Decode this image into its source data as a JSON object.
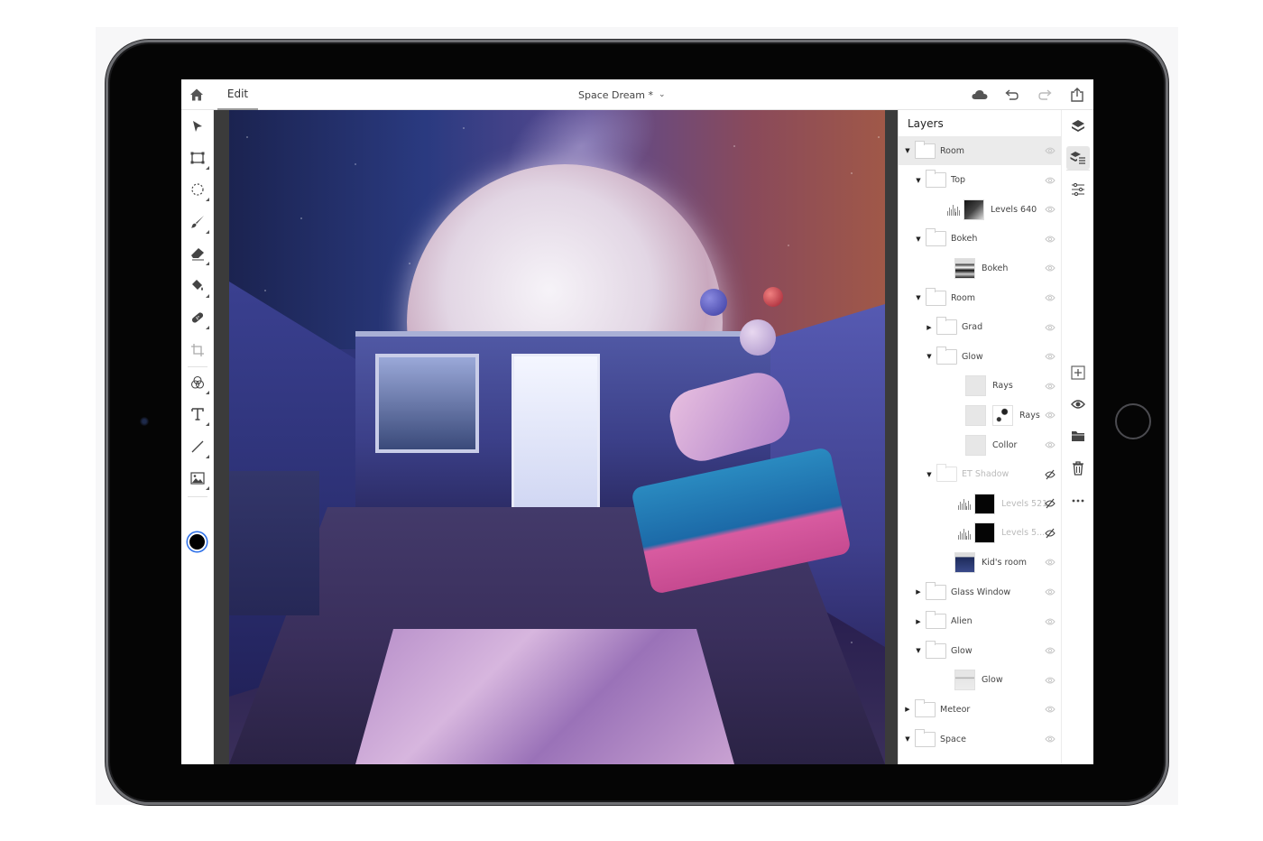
{
  "app": {
    "mode_tab": "Edit",
    "document_title": "Space Dream *",
    "title_dropdown_icon": "chevron-down-icon"
  },
  "topbar": {
    "home_icon": "home-icon",
    "right_icons": [
      "cloud-icon",
      "undo-icon",
      "redo-icon",
      "share-icon"
    ],
    "redo_enabled": false
  },
  "toolbar": {
    "tools": [
      {
        "name": "select",
        "icon": "arrow-pointer-icon",
        "has_submenu": false
      },
      {
        "name": "marquee",
        "icon": "rect-marquee-icon",
        "has_submenu": true
      },
      {
        "name": "lasso",
        "icon": "lasso-icon",
        "has_submenu": true
      },
      {
        "name": "brush",
        "icon": "brush-icon",
        "has_submenu": true
      },
      {
        "name": "eraser",
        "icon": "eraser-icon",
        "has_submenu": true
      },
      {
        "name": "fill",
        "icon": "paint-bucket-icon",
        "has_submenu": true
      },
      {
        "name": "heal",
        "icon": "bandage-icon",
        "has_submenu": true
      },
      {
        "name": "crop",
        "icon": "crop-icon",
        "has_submenu": false
      },
      {
        "name": "adjust",
        "icon": "adjustments-icon",
        "has_submenu": true
      },
      {
        "name": "type",
        "icon": "type-icon",
        "has_submenu": true
      },
      {
        "name": "line",
        "icon": "line-icon",
        "has_submenu": true
      },
      {
        "name": "place-image",
        "icon": "image-icon",
        "has_submenu": true
      }
    ],
    "foreground_color": "#000000",
    "background_color": "#ffffff"
  },
  "layers_panel": {
    "title": "Layers",
    "layers": [
      {
        "name": "Room",
        "type": "group",
        "depth": 0,
        "expanded": true,
        "visible": true,
        "selected": true
      },
      {
        "name": "Top",
        "type": "group",
        "depth": 1,
        "expanded": true,
        "visible": true
      },
      {
        "name": "Levels 640",
        "type": "adjustment",
        "depth": 2,
        "visible": true,
        "thumb": "gradient"
      },
      {
        "name": "Bokeh",
        "type": "group",
        "depth": 1,
        "expanded": true,
        "visible": true
      },
      {
        "name": "Bokeh",
        "type": "image",
        "depth": 2,
        "visible": true,
        "thumb": "bokeh"
      },
      {
        "name": "Room",
        "type": "group",
        "depth": 1,
        "expanded": true,
        "visible": true
      },
      {
        "name": "Grad",
        "type": "group",
        "depth": 2,
        "expanded": false,
        "visible": true
      },
      {
        "name": "Glow",
        "type": "group",
        "depth": 2,
        "expanded": true,
        "visible": true
      },
      {
        "name": "Rays",
        "type": "image",
        "depth": 3,
        "visible": true,
        "thumb": "light"
      },
      {
        "name": "Rays",
        "type": "masked",
        "depth": 3,
        "visible": true,
        "thumb": "light"
      },
      {
        "name": "Collor",
        "type": "image",
        "depth": 3,
        "visible": true,
        "thumb": "light"
      },
      {
        "name": "ET Shadow",
        "type": "group",
        "depth": 2,
        "expanded": true,
        "visible": false
      },
      {
        "name": "Levels 521",
        "type": "adjustment",
        "depth": 3,
        "visible": false,
        "thumb": "black"
      },
      {
        "name": "Levels 5...",
        "type": "adjustment",
        "depth": 3,
        "visible": false,
        "thumb": "black"
      },
      {
        "name": "Kid's room",
        "type": "image",
        "depth": 2,
        "visible": true,
        "thumb": "room"
      },
      {
        "name": "Glass Window",
        "type": "group",
        "depth": 1,
        "expanded": false,
        "visible": true
      },
      {
        "name": "Alien",
        "type": "group",
        "depth": 1,
        "expanded": false,
        "visible": true
      },
      {
        "name": "Glow",
        "type": "group",
        "depth": 1,
        "expanded": true,
        "visible": true
      },
      {
        "name": "Glow",
        "type": "image",
        "depth": 2,
        "visible": true,
        "thumb": "glow"
      },
      {
        "name": "Meteor",
        "type": "group",
        "depth": 0,
        "expanded": false,
        "visible": true
      },
      {
        "name": "Space",
        "type": "group",
        "depth": 0,
        "expanded": true,
        "visible": true
      }
    ]
  },
  "right_rail": {
    "top": [
      "layers-icon",
      "layer-properties-icon",
      "adjustments-sliders-icon"
    ],
    "active": "layer-properties-icon",
    "bottom": [
      "add-layer-icon",
      "visibility-icon",
      "group-folder-icon",
      "trash-icon",
      "more-icon"
    ]
  },
  "canvas": {
    "artwork_description": "Space Dream composite — kid floating in bedroom under a giant moon"
  }
}
